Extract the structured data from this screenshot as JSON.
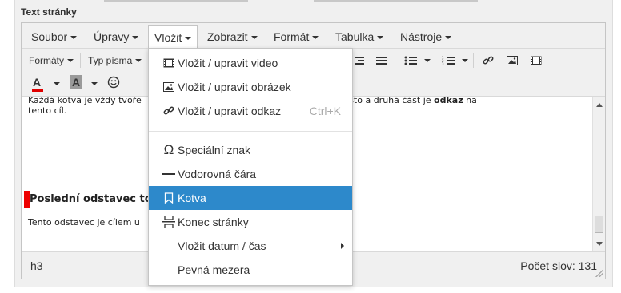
{
  "field_label": "Text stránky",
  "menubar": {
    "items": [
      {
        "label": "Soubor"
      },
      {
        "label": "Úpravy"
      },
      {
        "label": "Vložit"
      },
      {
        "label": "Zobrazit"
      },
      {
        "label": "Formát"
      },
      {
        "label": "Tabulka"
      },
      {
        "label": "Nástroje"
      }
    ],
    "active_index": 2
  },
  "toolbar": {
    "formats_label": "Formáty",
    "font_label": "Typ písma",
    "text_color_glyph": "A",
    "bg_color_glyph": "A",
    "emoji_icon": "smiley-icon",
    "colors": {
      "text_underline": "#e00000",
      "bg_swatch": "#9a9a9a"
    }
  },
  "content": {
    "para1_line1_a": "Každá kotva je vždy tvoře",
    "para1_line1_b": "otvy na určité místo a druhá část je ",
    "para1_line1_bold": "odkaz",
    "para1_line1_c": " na",
    "para1_line2": "tento cíl.",
    "heading": "Poslední odstavec to",
    "para2": "Tento odstavec je cílem u"
  },
  "statusbar": {
    "path": "h3",
    "wordcount": "Počet slov: 131"
  },
  "dropdown": {
    "items": [
      {
        "label": "Vložit / upravit video",
        "icon": "video-icon"
      },
      {
        "label": "Vložit / upravit obrázek",
        "icon": "image-icon"
      },
      {
        "label": "Vložit / upravit odkaz",
        "icon": "link-icon",
        "shortcut": "Ctrl+K"
      },
      {
        "label": "Speciální znak",
        "icon": "omega-icon"
      },
      {
        "label": "Vodorovná čára",
        "icon": "horizontal-line-icon"
      },
      {
        "label": "Kotva",
        "icon": "bookmark-icon",
        "selected": true
      },
      {
        "label": "Konec stránky",
        "icon": "page-break-icon"
      },
      {
        "label": "Vložit datum / čas",
        "icon": "",
        "submenu": true
      },
      {
        "label": "Pevná mezera",
        "icon": ""
      }
    ],
    "selected_color": "#2d89cb"
  }
}
